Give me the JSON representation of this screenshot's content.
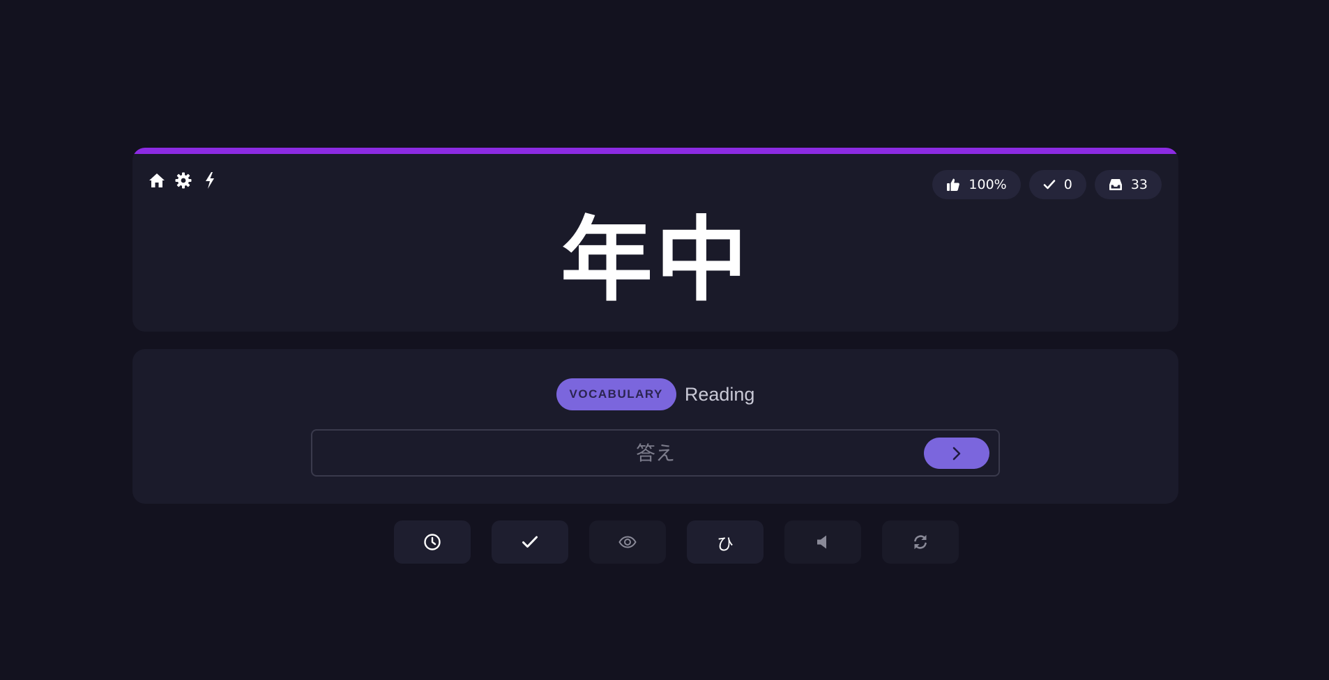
{
  "header": {
    "icons": [
      "home-icon",
      "gear-icon",
      "lightning-icon"
    ]
  },
  "stats": {
    "accuracy": "100%",
    "correct": "0",
    "remaining": "33"
  },
  "card": {
    "subject": "年中"
  },
  "prompt": {
    "badge": "VOCABULARY",
    "label": "Reading"
  },
  "answer": {
    "value": "",
    "placeholder": "答え"
  },
  "actions": {
    "kana_glyph": "ひ"
  },
  "colors": {
    "background": "#13121f",
    "card": "#1a1a29",
    "accent_bar": "#8c2be2",
    "badge": "#7b66dd",
    "pill": "#25253a"
  }
}
